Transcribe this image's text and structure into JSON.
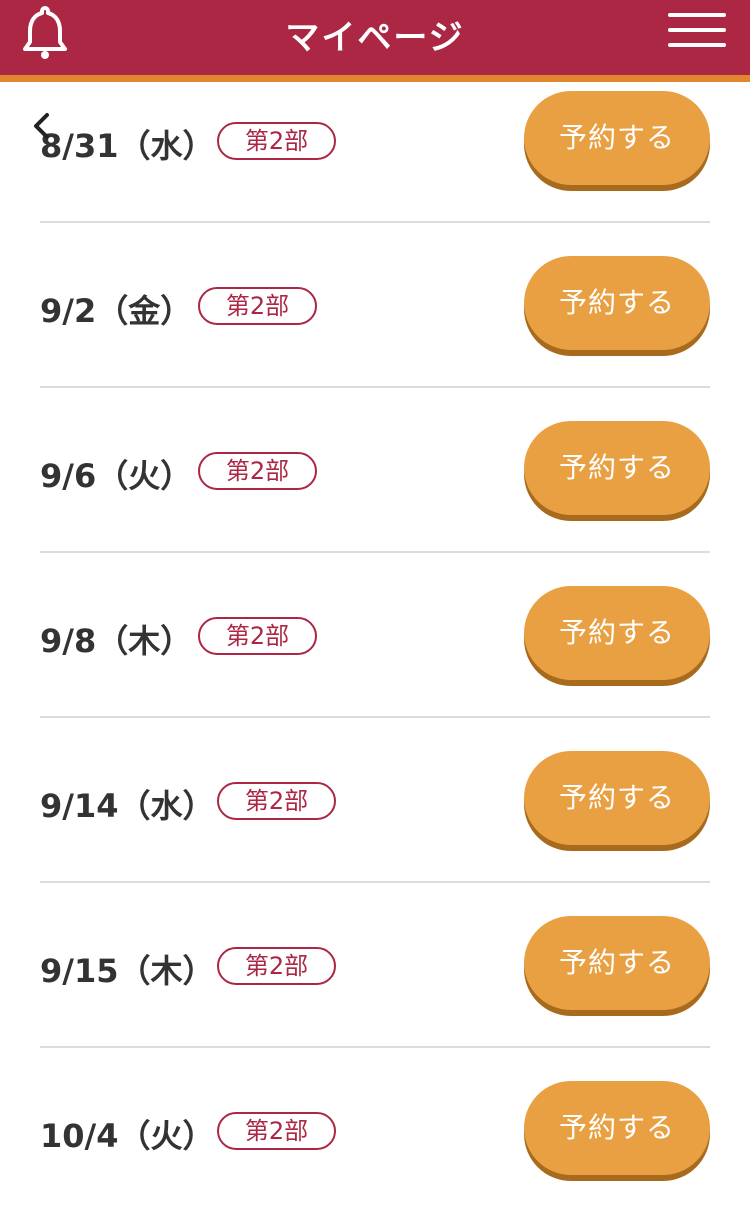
{
  "header": {
    "title": "マイページ",
    "bell_icon": "bell-icon",
    "menu_icon": "hamburger-menu-icon",
    "back_icon": "chevron-left-icon"
  },
  "colors": {
    "header": "#ab2744",
    "header_stripe": "#e0862f",
    "button": "#e8a043",
    "button_shadow": "#a86a1d",
    "badge": "#ab2744"
  },
  "rows": [
    {
      "date": "8/31（水）",
      "badge": "第2部",
      "button": "予約する"
    },
    {
      "date": "9/2（金）",
      "badge": "第2部",
      "button": "予約する"
    },
    {
      "date": "9/6（火）",
      "badge": "第2部",
      "button": "予約する"
    },
    {
      "date": "9/8（木）",
      "badge": "第2部",
      "button": "予約する"
    },
    {
      "date": "9/14（水）",
      "badge": "第2部",
      "button": "予約する"
    },
    {
      "date": "9/15（木）",
      "badge": "第2部",
      "button": "予約する"
    },
    {
      "date": "10/4（火）",
      "badge": "第2部",
      "button": "予約する"
    }
  ]
}
